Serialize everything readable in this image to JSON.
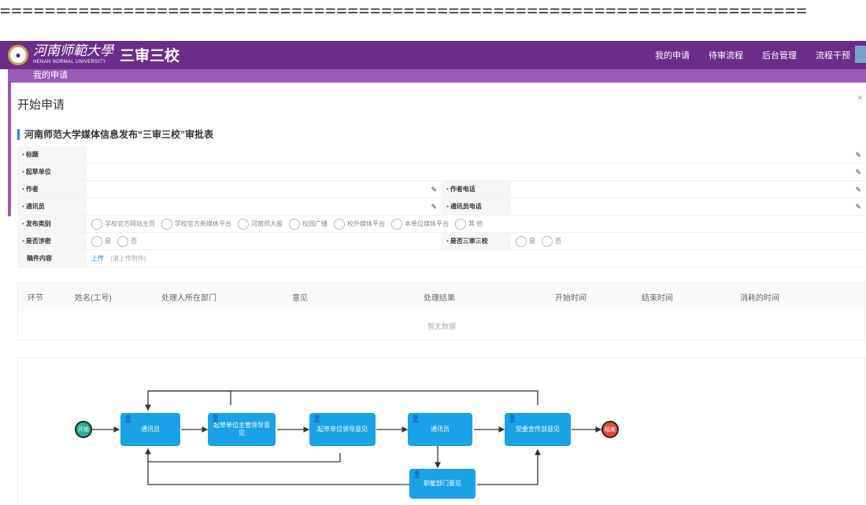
{
  "decor": {
    "dashes": "========================================================================"
  },
  "header": {
    "university_cn": "河南师範大學",
    "university_en": "HENAN NORMAL UNIVERSITY",
    "app_title": "三审三校",
    "nav": [
      "我的申请",
      "待审流程",
      "后台管理",
      "流程干预"
    ]
  },
  "subnav": {
    "label": "我的申请"
  },
  "page": {
    "title": "开始申请",
    "close": "×"
  },
  "form": {
    "section_title": "河南师范大学媒体信息发布“三审三校”审批表",
    "fields": {
      "title": "标题",
      "unit": "起草单位",
      "author": "作者",
      "author_phone": "作者电话",
      "correspondent": "通讯员",
      "correspondent_phone": "通讯员电话",
      "category": "发布类别",
      "secret": "是否涉密",
      "three_review": "是否三审三校",
      "content": "稿件内容"
    },
    "category_options": [
      "学校官方网站主页",
      "学校官方新媒体平台",
      "河南师大报",
      "校园广播",
      "校外媒体平台",
      "本单位媒体平台",
      "其 他"
    ],
    "yes": "是",
    "no": "否",
    "upload": "上传",
    "upload_hint": "(请上传附件)"
  },
  "table": {
    "columns": [
      "环节",
      "姓名(工号)",
      "处理人所在部门",
      "意见",
      "处理结果",
      "开始时间",
      "结束时间",
      "消耗的时间"
    ],
    "empty": "暂无数据"
  },
  "flow": {
    "start": "开始",
    "end": "结束",
    "nodes": [
      "通讯员",
      "起草单位主管领导意见",
      "起草单位领导意见",
      "通讯员",
      "党委宣传部意见",
      "职能部门意见"
    ]
  },
  "colors": {
    "primary": "#6b2c8a",
    "accent": "#9b59b6",
    "node": "#1aa1e6",
    "start": "#27ae9a",
    "end": "#e74c3c"
  }
}
